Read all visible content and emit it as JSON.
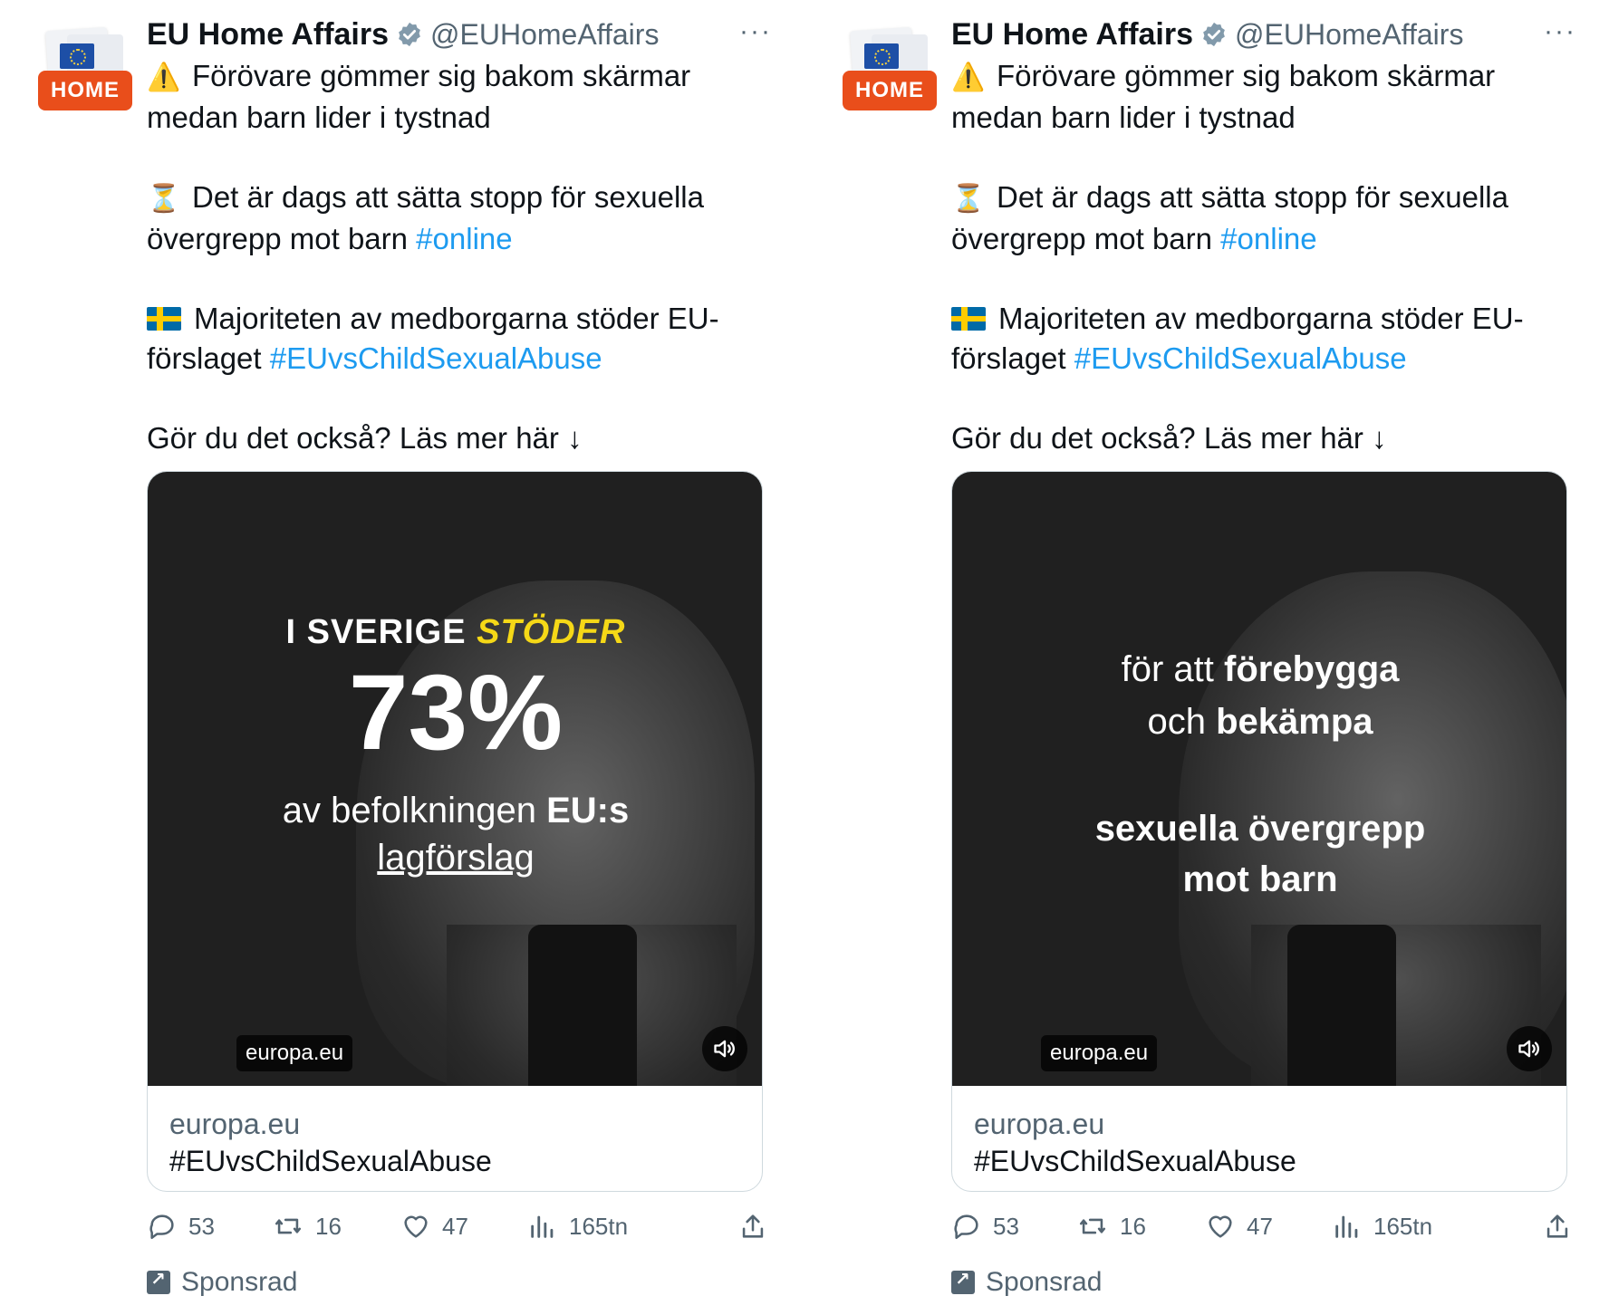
{
  "tweets": [
    {
      "avatar_badge": "HOME",
      "author_name": "EU Home Affairs",
      "author_handle": "@EUHomeAffairs",
      "more": "···",
      "para1_emoji": "⚠️",
      "para1": "Förövare gömmer sig bakom skärmar medan barn lider i tystnad",
      "para2_emoji": "⏳",
      "para2_text": "Det är dags att sätta stopp för sexuella övergrepp mot barn ",
      "para2_tag": "#online",
      "para3_text": "Majoriteten av medborgarna stöder EU-förslaget ",
      "para3_tag": "#EUvsChildSexualAbuse",
      "para4": "Gör du det också? Läs mer här ↓",
      "media": {
        "line1_a": "I SVERIGE ",
        "line1_b": "STÖDER",
        "big_number": "73%",
        "line3_a": "av befolkningen ",
        "line3_b": "EU:s",
        "line4": "lagförslag",
        "chip": "europa.eu"
      },
      "card_domain": "europa.eu",
      "card_title": "#EUvsChildSexualAbuse",
      "stats": {
        "replies": "53",
        "reposts": "16",
        "likes": "47",
        "views": "165tn"
      },
      "sponsored": "Sponsrad"
    },
    {
      "avatar_badge": "HOME",
      "author_name": "EU Home Affairs",
      "author_handle": "@EUHomeAffairs",
      "more": "···",
      "para1_emoji": "⚠️",
      "para1": "Förövare gömmer sig bakom skärmar medan barn lider i tystnad",
      "para2_emoji": "⏳",
      "para2_text": "Det är dags att sätta stopp för sexuella övergrepp mot barn ",
      "para2_tag": "#online",
      "para3_text": "Majoriteten av medborgarna stöder EU-förslaget ",
      "para3_tag": "#EUvsChildSexualAbuse",
      "para4": "Gör du det också? Läs mer här ↓",
      "media": {
        "line1_a": "för att ",
        "line1_b": "förebygga",
        "line2_a": "och ",
        "line2_b": "bekämpa",
        "line3": "sexuella övergrepp",
        "line4": "mot barn",
        "chip": "europa.eu"
      },
      "card_domain": "europa.eu",
      "card_title": "#EUvsChildSexualAbuse",
      "stats": {
        "replies": "53",
        "reposts": "16",
        "likes": "47",
        "views": "165tn"
      },
      "sponsored": "Sponsrad"
    }
  ],
  "colors": {
    "accent": "#1d9bf0",
    "badge": "#e94e1b",
    "highlight": "#f5d817",
    "muted": "#536471"
  },
  "icons": [
    "verified-badge-icon",
    "more-icon",
    "warning-icon",
    "hourglass-icon",
    "sweden-flag-icon",
    "sound-icon",
    "reply-icon",
    "repost-icon",
    "like-icon",
    "views-icon",
    "share-icon",
    "sponsored-icon"
  ]
}
